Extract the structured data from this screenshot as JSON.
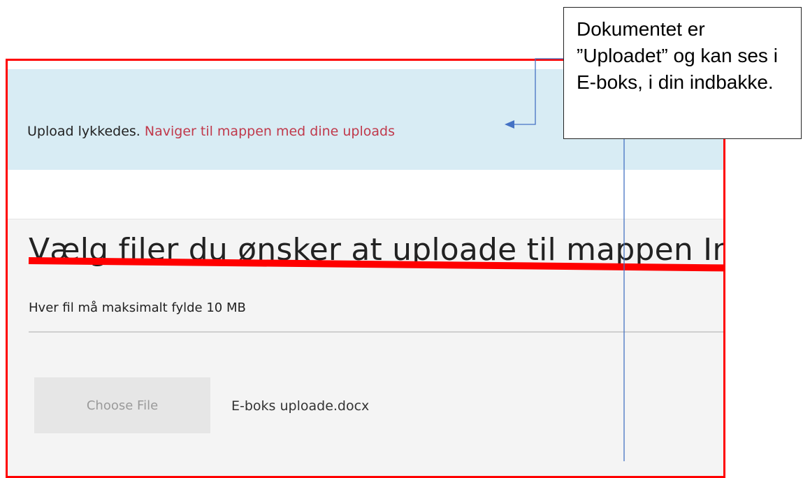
{
  "banner": {
    "status_text": "Upload lykkedes.",
    "link_text": "Naviger til mappen med dine uploads"
  },
  "upload_form": {
    "heading": "Vælg filer du ønsker at uploade til mappen Indbakke",
    "size_note": "Hver fil må maksimalt fylde 10 MB",
    "choose_button_label": "Choose File",
    "selected_file": "E-boks uploade.docx"
  },
  "annotation": {
    "callout_text": "Dokumentet er ”Uploadet” og kan ses i E-boks, i din indbakke.",
    "frame_color": "#ff0000",
    "strike_color": "#ff0000",
    "connector_color": "#4472c4"
  },
  "colors": {
    "banner_bg": "#d8ecf4",
    "link": "#c0394b",
    "panel_bg": "#f4f4f4"
  }
}
